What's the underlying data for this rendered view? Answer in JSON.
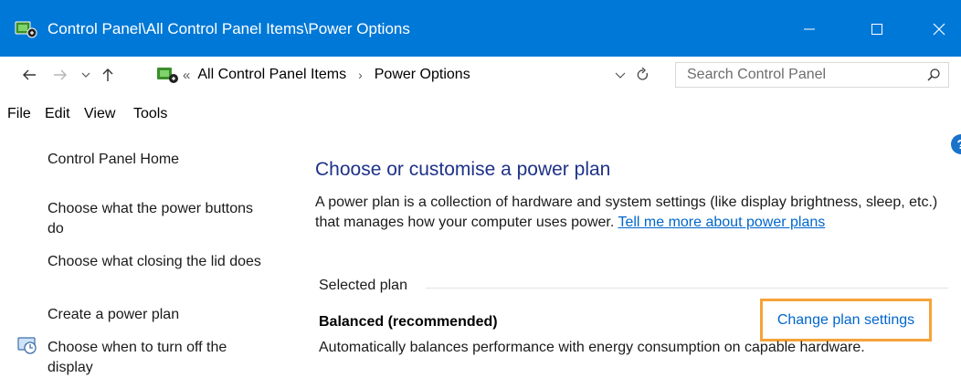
{
  "window": {
    "title": "Control Panel\\All Control Panel Items\\Power Options"
  },
  "address": {
    "chevron": "«",
    "crumbs": [
      "All Control Panel Items",
      "Power Options"
    ],
    "separator": "›"
  },
  "search": {
    "placeholder": "Search Control Panel"
  },
  "menu": [
    "File",
    "Edit",
    "View",
    "Tools"
  ],
  "sidebar": {
    "items": [
      {
        "label": "Control Panel Home"
      },
      {
        "label": "Choose what the power buttons do"
      },
      {
        "label": "Choose what closing the lid does"
      },
      {
        "label": "Create a power plan"
      },
      {
        "label": "Choose when to turn off the display"
      }
    ]
  },
  "main": {
    "title": "Choose or customise a power plan",
    "description": "A power plan is a collection of hardware and system settings (like display brightness, sleep, etc.) that manages how your computer uses power. ",
    "learn_more": "Tell me more about power plans",
    "selected_label": "Selected plan",
    "plan": {
      "name": "Balanced (recommended)",
      "change_link": "Change plan settings",
      "description": "Automatically balances performance with energy consumption on capable hardware."
    }
  },
  "colors": {
    "titlebar": "#0078d7",
    "link": "#0066cc",
    "heading": "#1e3287",
    "highlight": "#f6a33a"
  }
}
